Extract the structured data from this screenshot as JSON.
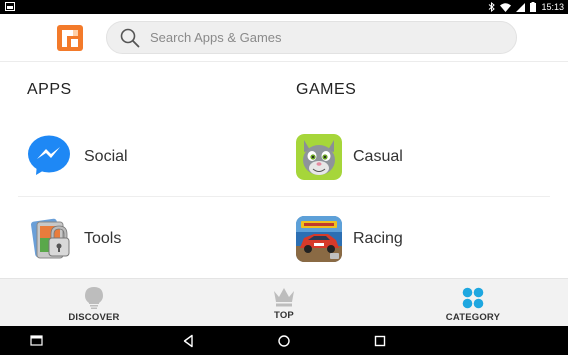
{
  "status_bar": {
    "time": "15:13"
  },
  "header": {
    "logo_icon": "app-store-logo-icon",
    "search": {
      "placeholder": "Search Apps & Games",
      "value": ""
    }
  },
  "sections": {
    "apps": {
      "title": "APPS",
      "items": [
        {
          "label": "Social",
          "icon": "messenger-icon"
        },
        {
          "label": "Tools",
          "icon": "app-lock-icon"
        }
      ]
    },
    "games": {
      "title": "GAMES",
      "items": [
        {
          "label": "Casual",
          "icon": "talking-tom-icon"
        },
        {
          "label": "Racing",
          "icon": "asphalt-racing-icon"
        }
      ]
    }
  },
  "tabs": [
    {
      "label": "DISCOVER",
      "icon": "lightbulb-icon",
      "active": false
    },
    {
      "label": "TOP",
      "icon": "crown-icon",
      "active": false
    },
    {
      "label": "CATEGORY",
      "icon": "grid-icon",
      "active": true
    }
  ],
  "colors": {
    "accent": "#1ea7e0",
    "logo": "#f37a2a",
    "tab_inactive_icon": "#bdbdbd",
    "messenger": "#1e88f5"
  }
}
